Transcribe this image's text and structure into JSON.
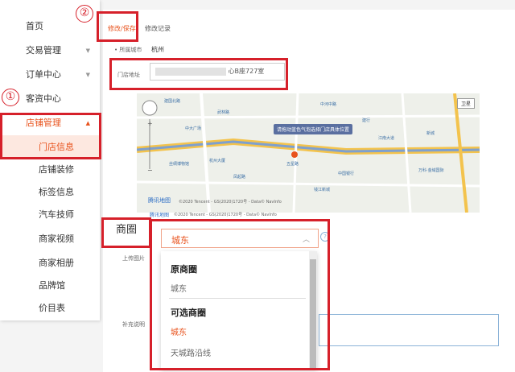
{
  "annotations": {
    "one": "①",
    "two": "②"
  },
  "sidebar": {
    "items": [
      {
        "label": "首页",
        "chevron": ""
      },
      {
        "label": "交易管理",
        "chevron": "▼"
      },
      {
        "label": "订单中心",
        "chevron": "▼"
      },
      {
        "label": "客资中心",
        "chevron": ""
      },
      {
        "label": "店铺管理",
        "chevron": "▲"
      }
    ],
    "subitems": [
      "门店信息",
      "店铺装修",
      "标签信息",
      "汽车技师",
      "商家视频",
      "商家相册",
      "品牌馆",
      "价目表"
    ]
  },
  "tabs": {
    "edit": "修改/保存",
    "history": "修改记录"
  },
  "form": {
    "city_label": "• 所属城市",
    "city_value": "杭州",
    "address_label": "门店地址",
    "address_value": "心B座727室",
    "upload_label": "上传图片",
    "note_label": "补充说明"
  },
  "map": {
    "tooltip": "请拖动蓝色气泡选择门店具体位置",
    "satellite": "卫星",
    "watermark": "腾讯地图",
    "copyright": "©2020 Tencent - GS(2020)1720号 - Data© NavInfo",
    "copyright2": "©2020 Tencent - GS(2020)1720号 - Data© NavInfo",
    "logo2": "腾讯地图",
    "labels": [
      "建国北路",
      "武林路",
      "中河中路",
      "五星路",
      "江南大道",
      "中大广场",
      "新城",
      "万科·金域国际",
      "中国银行",
      "凤起路",
      "建行",
      "丝绸博物馆",
      "杭州大厦",
      "钱江新城"
    ]
  },
  "shangquan": {
    "label": "商圈",
    "selected": "城东",
    "arrow": "︿",
    "group1_title": "原商圈",
    "group1_items": [
      "城东"
    ],
    "group2_title": "可选商圈",
    "group2_items": [
      "城东",
      "天城路沿线"
    ]
  },
  "colors": {
    "accent": "#e8521c",
    "annotation": "#d6202a"
  }
}
